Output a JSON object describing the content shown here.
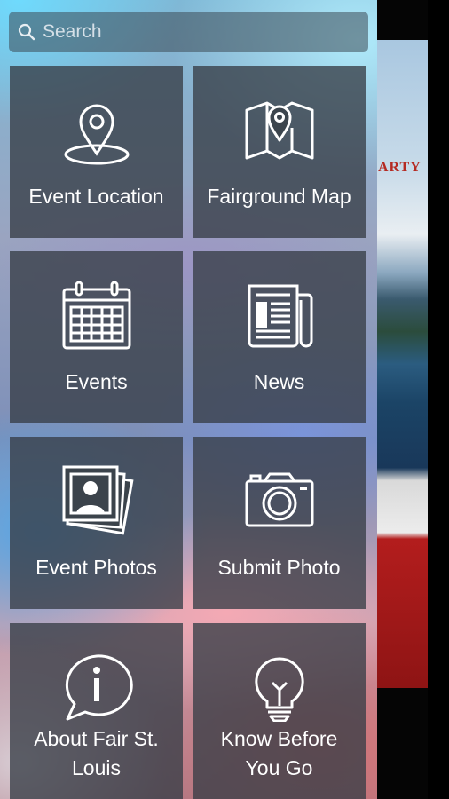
{
  "search": {
    "placeholder": "Search",
    "icon": "search-icon"
  },
  "background_screen": {
    "partial_text": "ARTY"
  },
  "menu": {
    "items": [
      {
        "label": "Event Location",
        "icon": "map-pin-icon"
      },
      {
        "label": "Fairground Map",
        "icon": "folded-map-icon"
      },
      {
        "label": "Events",
        "icon": "calendar-icon"
      },
      {
        "label": "News",
        "icon": "newspaper-icon"
      },
      {
        "label": "Event Photos",
        "icon": "photo-stack-icon"
      },
      {
        "label": "Submit Photo",
        "icon": "camera-icon"
      },
      {
        "label": "About Fair St. Louis",
        "icon": "info-speech-bubble-icon"
      },
      {
        "label": "Know Before You Go",
        "icon": "lightbulb-icon"
      }
    ]
  },
  "colors": {
    "tile": "#373e46",
    "text": "#ffffff"
  }
}
